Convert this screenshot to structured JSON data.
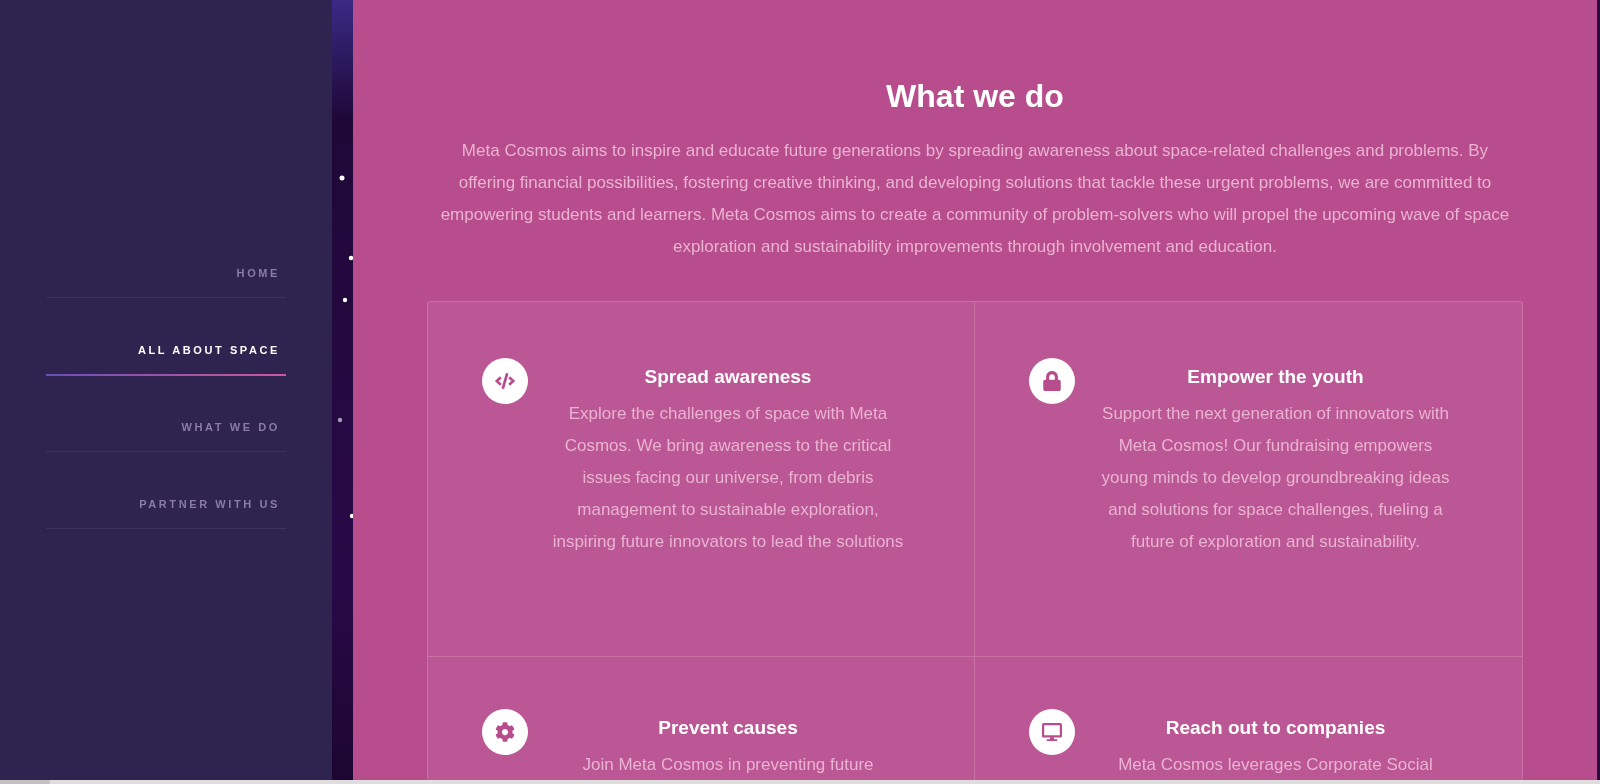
{
  "nav": [
    {
      "label": "HOME",
      "selected": false
    },
    {
      "label": "ALL ABOUT SPACE",
      "selected": true
    },
    {
      "label": "WHAT WE DO",
      "selected": false
    },
    {
      "label": "PARTNER WITH US",
      "selected": false
    }
  ],
  "section": {
    "title": "What we do",
    "intro": "Meta Cosmos aims to inspire and educate future generations by spreading awareness about space-related challenges and problems. By offering financial possibilities, fostering creative thinking, and developing solutions that tackle these urgent problems, we are committed to empowering students and learners. Meta Cosmos aims to create a community of problem-solvers who will propel the upcoming wave of space exploration and sustainability improvements through involvement and education."
  },
  "features": [
    {
      "kind": "code",
      "title": "Spread awareness",
      "text": "Explore the challenges of space with Meta Cosmos. We bring awareness to the critical issues facing our universe, from debris management to sustainable exploration, inspiring future innovators to lead the solutions"
    },
    {
      "kind": "lock",
      "title": "Empower the youth",
      "text": "Support the next generation of innovators with Meta Cosmos! Our fundraising empowers young minds to develop groundbreaking ideas and solutions for space challenges, fueling a future of exploration and sustainability."
    },
    {
      "kind": "gear",
      "title": "Prevent causes",
      "text": "Join Meta Cosmos in preventing future"
    },
    {
      "kind": "monitor",
      "title": "Reach out to companies",
      "text": "Meta Cosmos leverages Corporate Social"
    }
  ]
}
